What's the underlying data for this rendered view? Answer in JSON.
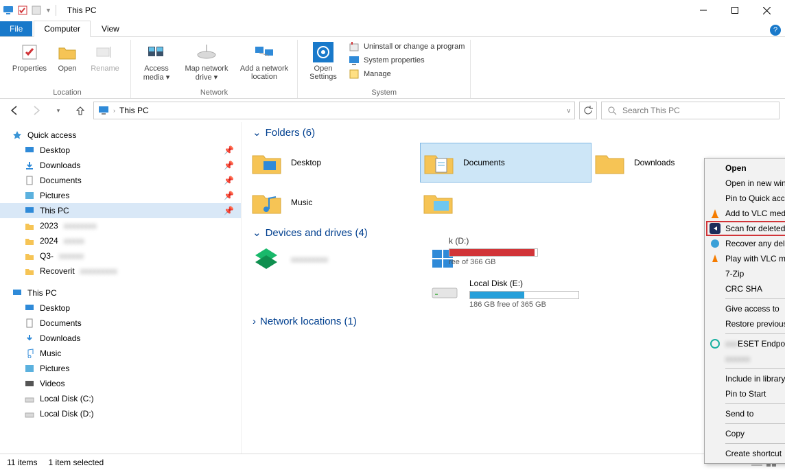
{
  "window": {
    "title": "This PC"
  },
  "tabs": {
    "file": "File",
    "computer": "Computer",
    "view": "View"
  },
  "ribbon": {
    "properties": "Properties",
    "open": "Open",
    "rename": "Rename",
    "access_media": "Access media ▾",
    "map_drive": "Map network drive ▾",
    "add_location": "Add a network location",
    "open_settings": "Open Settings",
    "uninstall": "Uninstall or change a program",
    "sysprops": "System properties",
    "manage": "Manage",
    "group_location": "Location",
    "group_network": "Network",
    "group_system": "System"
  },
  "breadcrumb": {
    "root": "This PC"
  },
  "search": {
    "placeholder": "Search This PC"
  },
  "nav": {
    "quick_access": "Quick access",
    "desktop": "Desktop",
    "downloads": "Downloads",
    "documents": "Documents",
    "pictures": "Pictures",
    "this_pc": "This PC",
    "y2023": "2023",
    "y2024": "2024",
    "q3": "Q3-",
    "recoverit": "Recoverit",
    "this_pc2": "This PC",
    "desktop2": "Desktop",
    "documents2": "Documents",
    "downloads2": "Downloads",
    "music": "Music",
    "pictures2": "Pictures",
    "videos": "Videos",
    "diskc": "Local Disk (C:)",
    "diskd": "Local Disk (D:)"
  },
  "sections": {
    "folders": "Folders (6)",
    "drives": "Devices and drives (4)",
    "network": "Network locations (1)"
  },
  "folders": {
    "desktop": "Desktop",
    "documents": "Documents",
    "downloads": "Downloads",
    "music": "Music"
  },
  "drives": {
    "e_label": "Local Disk (E:)",
    "e_free": "186 GB free of 365 GB",
    "d_label": "k (D:)",
    "d_free": "ree of 366 GB"
  },
  "context_menu": {
    "open": "Open",
    "open_new": "Open in new window",
    "pin_qa": "Pin to Quick access",
    "vlc_playlist": "Add to VLC media player's Playlist",
    "recoverit": "Scan for deleted files with Recoverit",
    "easeus": "Recover any deleted data with EaseUS",
    "vlc_play": "Play with VLC media player",
    "sevenzip": "7-Zip",
    "crc": "CRC SHA",
    "give_access": "Give access to",
    "restore": "Restore previous versions",
    "eset": "ESET Endpoint Antivirus",
    "include": "Include in library",
    "pin_start": "Pin to Start",
    "send_to": "Send to",
    "copy": "Copy",
    "shortcut": "Create shortcut"
  },
  "status": {
    "count": "11 items",
    "selected": "1 item selected"
  }
}
